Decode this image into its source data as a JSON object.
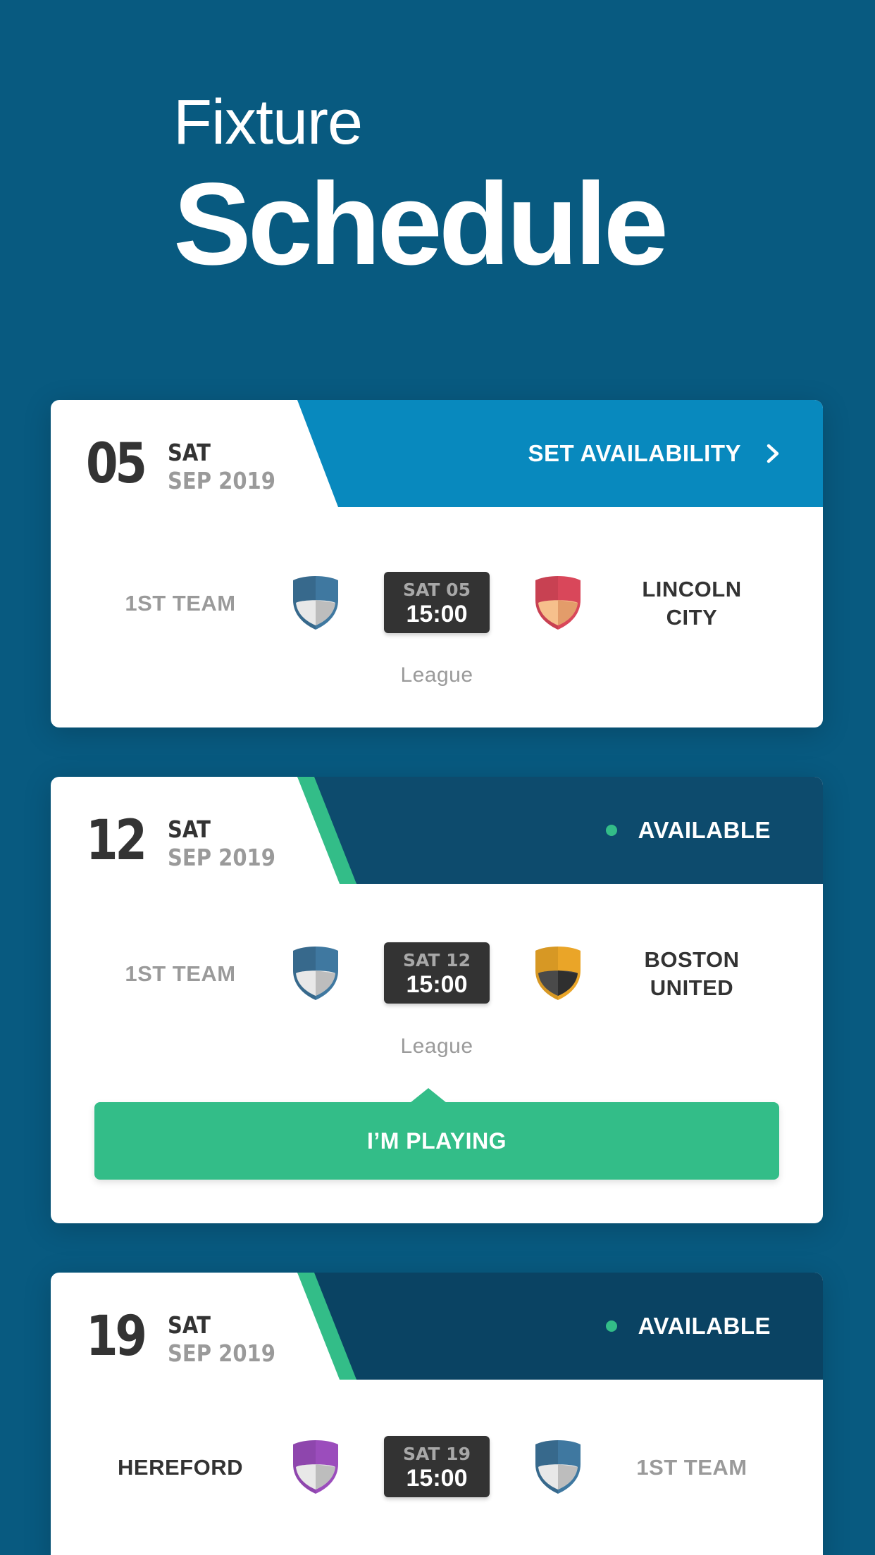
{
  "heading": {
    "line1": "Fixture",
    "line2": "Schedule"
  },
  "colors": {
    "background": "#085a80",
    "set_availability_band": "#0889be",
    "available_band": "#0d4b6d",
    "available_band_dark": "#0a4363",
    "accent_green": "#33bd88",
    "kickoff_box": "#333333"
  },
  "fixtures": [
    {
      "date_num": "05",
      "day": "SAT",
      "month": "SEP 2019",
      "action_label": "SET AVAILABILITY",
      "action_icon": "chevron-right-icon",
      "home_team": "1ST TEAM",
      "home_crest_color": "#3f78a0",
      "kickoff_day": "SAT 05",
      "kickoff_time": "15:00",
      "away_team": "LINCOLN\nCITY",
      "away_crest_color": "#d9475a",
      "competition": "League"
    },
    {
      "date_num": "12",
      "day": "SAT",
      "month": "SEP 2019",
      "status_label": "AVAILABLE",
      "home_team": "1ST TEAM",
      "home_crest_color": "#3f78a0",
      "kickoff_day": "SAT 12",
      "kickoff_time": "15:00",
      "away_team": "BOSTON\nUNITED",
      "away_crest_color": "#eaa528",
      "competition": "League",
      "play_button": "I’M PLAYING"
    },
    {
      "date_num": "19",
      "day": "SAT",
      "month": "SEP 2019",
      "status_label": "AVAILABLE",
      "home_team": "HEREFORD",
      "home_crest_color": "#9b4dbc",
      "kickoff_day": "SAT 19",
      "kickoff_time": "15:00",
      "away_team": "1ST TEAM",
      "away_crest_color": "#3f78a0"
    }
  ]
}
